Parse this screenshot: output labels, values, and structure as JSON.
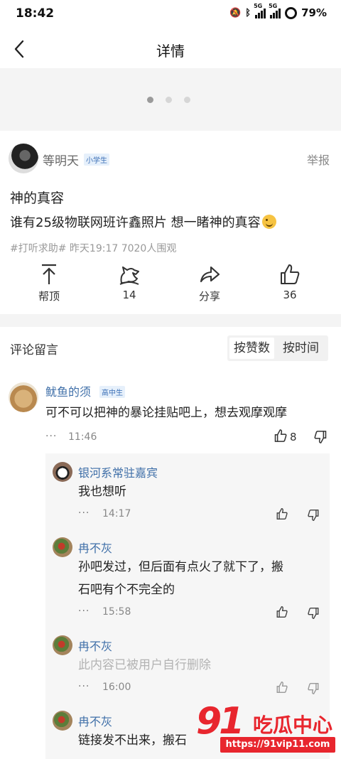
{
  "status_bar": {
    "time": "18:42",
    "network_label": "5G",
    "battery": "79%"
  },
  "nav": {
    "title": "详情"
  },
  "banner": {
    "dot_count": 3,
    "active_dot": 1
  },
  "post": {
    "author": "等明天",
    "author_badge": "小学生",
    "report": "举报",
    "title": "神的真容",
    "body": "谁有25级物联网班许鑫照片 想一睹神的真容",
    "meta": "#打听求助#  昨天19:17 7020人围观",
    "actions": [
      {
        "label": "帮顶",
        "icon": "arrow-up-icon"
      },
      {
        "label": "14",
        "icon": "horse-icon"
      },
      {
        "label": "分享",
        "icon": "share-icon"
      },
      {
        "label": "36",
        "icon": "thumb-up-icon"
      }
    ]
  },
  "comments": {
    "header": "评论留言",
    "sort_options": [
      "按赞数",
      "按时间"
    ],
    "active_sort": "按赞数",
    "top": {
      "author": "鱿鱼的须",
      "badge": "高中生",
      "text": "可不可以把神的暴论挂贴吧上，想去观摩观摩",
      "more": "···",
      "time": "11:46",
      "likes": "8"
    },
    "replies": [
      {
        "author": "银河系常驻嘉宾",
        "text_lines": [
          "我也想听"
        ],
        "more": "···",
        "time": "14:17"
      },
      {
        "author": "冉不灰",
        "text_lines": [
          "孙吧发过，但后面有点火了就下了，搬",
          "石吧有个不完全的"
        ],
        "more": "···",
        "time": "15:58"
      },
      {
        "author": "冉不灰",
        "text_lines": [
          "此内容已被用户自行删除"
        ],
        "more": "···",
        "time": "16:00"
      },
      {
        "author": "冉不灰",
        "text_lines": [
          "链接发不出来，搬石"
        ],
        "more": "",
        "time": ""
      }
    ]
  },
  "watermark": {
    "logo_digits": "91",
    "logo_text": "吃瓜中心",
    "url": "https://91vip11.com"
  },
  "colors": {
    "link_blue": "#3f6fa8",
    "watermark_red": "#e8262e",
    "panel_gray": "#f6f6f6"
  }
}
